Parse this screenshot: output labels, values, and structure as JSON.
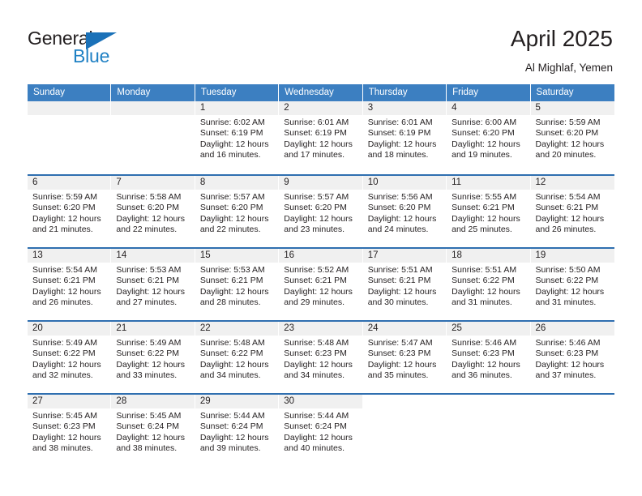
{
  "brand": {
    "name_top": "General",
    "name_bottom": "Blue",
    "accent_color": "#2081c4",
    "triangle_color": "#1a71b8"
  },
  "header": {
    "title": "April 2025",
    "subtitle": "Al Mighlaf, Yemen"
  },
  "theme": {
    "header_row_bg": "#3c7fc1",
    "row_divider": "#2f6fb0",
    "day_band_bg": "#f0f0f0",
    "text_color": "#231f20"
  },
  "weekdays": [
    "Sunday",
    "Monday",
    "Tuesday",
    "Wednesday",
    "Thursday",
    "Friday",
    "Saturday"
  ],
  "weeks": [
    [
      {
        "day": "",
        "sunrise": "",
        "sunset": "",
        "daylight_1": "",
        "daylight_2": "",
        "blank": true
      },
      {
        "day": "",
        "sunrise": "",
        "sunset": "",
        "daylight_1": "",
        "daylight_2": "",
        "blank": true
      },
      {
        "day": "1",
        "sunrise": "Sunrise: 6:02 AM",
        "sunset": "Sunset: 6:19 PM",
        "daylight_1": "Daylight: 12 hours",
        "daylight_2": "and 16 minutes."
      },
      {
        "day": "2",
        "sunrise": "Sunrise: 6:01 AM",
        "sunset": "Sunset: 6:19 PM",
        "daylight_1": "Daylight: 12 hours",
        "daylight_2": "and 17 minutes."
      },
      {
        "day": "3",
        "sunrise": "Sunrise: 6:01 AM",
        "sunset": "Sunset: 6:19 PM",
        "daylight_1": "Daylight: 12 hours",
        "daylight_2": "and 18 minutes."
      },
      {
        "day": "4",
        "sunrise": "Sunrise: 6:00 AM",
        "sunset": "Sunset: 6:20 PM",
        "daylight_1": "Daylight: 12 hours",
        "daylight_2": "and 19 minutes."
      },
      {
        "day": "5",
        "sunrise": "Sunrise: 5:59 AM",
        "sunset": "Sunset: 6:20 PM",
        "daylight_1": "Daylight: 12 hours",
        "daylight_2": "and 20 minutes."
      }
    ],
    [
      {
        "day": "6",
        "sunrise": "Sunrise: 5:59 AM",
        "sunset": "Sunset: 6:20 PM",
        "daylight_1": "Daylight: 12 hours",
        "daylight_2": "and 21 minutes."
      },
      {
        "day": "7",
        "sunrise": "Sunrise: 5:58 AM",
        "sunset": "Sunset: 6:20 PM",
        "daylight_1": "Daylight: 12 hours",
        "daylight_2": "and 22 minutes."
      },
      {
        "day": "8",
        "sunrise": "Sunrise: 5:57 AM",
        "sunset": "Sunset: 6:20 PM",
        "daylight_1": "Daylight: 12 hours",
        "daylight_2": "and 22 minutes."
      },
      {
        "day": "9",
        "sunrise": "Sunrise: 5:57 AM",
        "sunset": "Sunset: 6:20 PM",
        "daylight_1": "Daylight: 12 hours",
        "daylight_2": "and 23 minutes."
      },
      {
        "day": "10",
        "sunrise": "Sunrise: 5:56 AM",
        "sunset": "Sunset: 6:20 PM",
        "daylight_1": "Daylight: 12 hours",
        "daylight_2": "and 24 minutes."
      },
      {
        "day": "11",
        "sunrise": "Sunrise: 5:55 AM",
        "sunset": "Sunset: 6:21 PM",
        "daylight_1": "Daylight: 12 hours",
        "daylight_2": "and 25 minutes."
      },
      {
        "day": "12",
        "sunrise": "Sunrise: 5:54 AM",
        "sunset": "Sunset: 6:21 PM",
        "daylight_1": "Daylight: 12 hours",
        "daylight_2": "and 26 minutes."
      }
    ],
    [
      {
        "day": "13",
        "sunrise": "Sunrise: 5:54 AM",
        "sunset": "Sunset: 6:21 PM",
        "daylight_1": "Daylight: 12 hours",
        "daylight_2": "and 26 minutes."
      },
      {
        "day": "14",
        "sunrise": "Sunrise: 5:53 AM",
        "sunset": "Sunset: 6:21 PM",
        "daylight_1": "Daylight: 12 hours",
        "daylight_2": "and 27 minutes."
      },
      {
        "day": "15",
        "sunrise": "Sunrise: 5:53 AM",
        "sunset": "Sunset: 6:21 PM",
        "daylight_1": "Daylight: 12 hours",
        "daylight_2": "and 28 minutes."
      },
      {
        "day": "16",
        "sunrise": "Sunrise: 5:52 AM",
        "sunset": "Sunset: 6:21 PM",
        "daylight_1": "Daylight: 12 hours",
        "daylight_2": "and 29 minutes."
      },
      {
        "day": "17",
        "sunrise": "Sunrise: 5:51 AM",
        "sunset": "Sunset: 6:21 PM",
        "daylight_1": "Daylight: 12 hours",
        "daylight_2": "and 30 minutes."
      },
      {
        "day": "18",
        "sunrise": "Sunrise: 5:51 AM",
        "sunset": "Sunset: 6:22 PM",
        "daylight_1": "Daylight: 12 hours",
        "daylight_2": "and 31 minutes."
      },
      {
        "day": "19",
        "sunrise": "Sunrise: 5:50 AM",
        "sunset": "Sunset: 6:22 PM",
        "daylight_1": "Daylight: 12 hours",
        "daylight_2": "and 31 minutes."
      }
    ],
    [
      {
        "day": "20",
        "sunrise": "Sunrise: 5:49 AM",
        "sunset": "Sunset: 6:22 PM",
        "daylight_1": "Daylight: 12 hours",
        "daylight_2": "and 32 minutes."
      },
      {
        "day": "21",
        "sunrise": "Sunrise: 5:49 AM",
        "sunset": "Sunset: 6:22 PM",
        "daylight_1": "Daylight: 12 hours",
        "daylight_2": "and 33 minutes."
      },
      {
        "day": "22",
        "sunrise": "Sunrise: 5:48 AM",
        "sunset": "Sunset: 6:22 PM",
        "daylight_1": "Daylight: 12 hours",
        "daylight_2": "and 34 minutes."
      },
      {
        "day": "23",
        "sunrise": "Sunrise: 5:48 AM",
        "sunset": "Sunset: 6:23 PM",
        "daylight_1": "Daylight: 12 hours",
        "daylight_2": "and 34 minutes."
      },
      {
        "day": "24",
        "sunrise": "Sunrise: 5:47 AM",
        "sunset": "Sunset: 6:23 PM",
        "daylight_1": "Daylight: 12 hours",
        "daylight_2": "and 35 minutes."
      },
      {
        "day": "25",
        "sunrise": "Sunrise: 5:46 AM",
        "sunset": "Sunset: 6:23 PM",
        "daylight_1": "Daylight: 12 hours",
        "daylight_2": "and 36 minutes."
      },
      {
        "day": "26",
        "sunrise": "Sunrise: 5:46 AM",
        "sunset": "Sunset: 6:23 PM",
        "daylight_1": "Daylight: 12 hours",
        "daylight_2": "and 37 minutes."
      }
    ],
    [
      {
        "day": "27",
        "sunrise": "Sunrise: 5:45 AM",
        "sunset": "Sunset: 6:23 PM",
        "daylight_1": "Daylight: 12 hours",
        "daylight_2": "and 38 minutes."
      },
      {
        "day": "28",
        "sunrise": "Sunrise: 5:45 AM",
        "sunset": "Sunset: 6:24 PM",
        "daylight_1": "Daylight: 12 hours",
        "daylight_2": "and 38 minutes."
      },
      {
        "day": "29",
        "sunrise": "Sunrise: 5:44 AM",
        "sunset": "Sunset: 6:24 PM",
        "daylight_1": "Daylight: 12 hours",
        "daylight_2": "and 39 minutes."
      },
      {
        "day": "30",
        "sunrise": "Sunrise: 5:44 AM",
        "sunset": "Sunset: 6:24 PM",
        "daylight_1": "Daylight: 12 hours",
        "daylight_2": "and 40 minutes."
      },
      {
        "day": "",
        "sunrise": "",
        "sunset": "",
        "daylight_1": "",
        "daylight_2": "",
        "empty": true
      },
      {
        "day": "",
        "sunrise": "",
        "sunset": "",
        "daylight_1": "",
        "daylight_2": "",
        "empty": true
      },
      {
        "day": "",
        "sunrise": "",
        "sunset": "",
        "daylight_1": "",
        "daylight_2": "",
        "empty": true
      }
    ]
  ]
}
